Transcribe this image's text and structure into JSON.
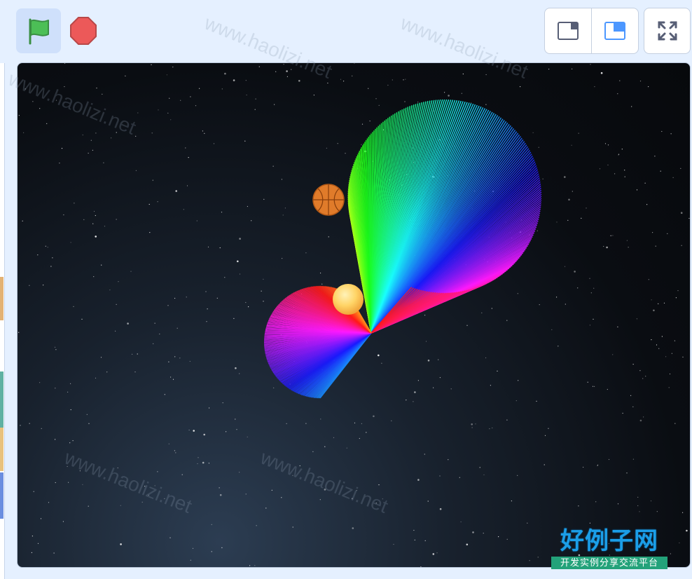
{
  "toolbar": {
    "green_flag_icon": "green-flag-icon",
    "stop_icon": "stop-sign-icon"
  },
  "layout_modes": {
    "small_stage_icon": "small-stage-mode-icon",
    "normal_stage_icon": "normal-stage-mode-icon",
    "fullscreen_icon": "fullscreen-icon"
  },
  "stage": {
    "backdrop": "starry-night-sky",
    "sprites": [
      "basketball",
      "glowing-ball",
      "rainbow-pen-drawing"
    ]
  },
  "watermark": {
    "logo_title": "好例子网",
    "logo_subtitle": "开发实例分享交流平台",
    "url_text": "www.haolizi.net"
  },
  "colors": {
    "page_background": "#e5f0ff",
    "flag_green": "#4cbf56",
    "stop_red": "#ec5959",
    "mode_blue": "#4c97ff"
  }
}
